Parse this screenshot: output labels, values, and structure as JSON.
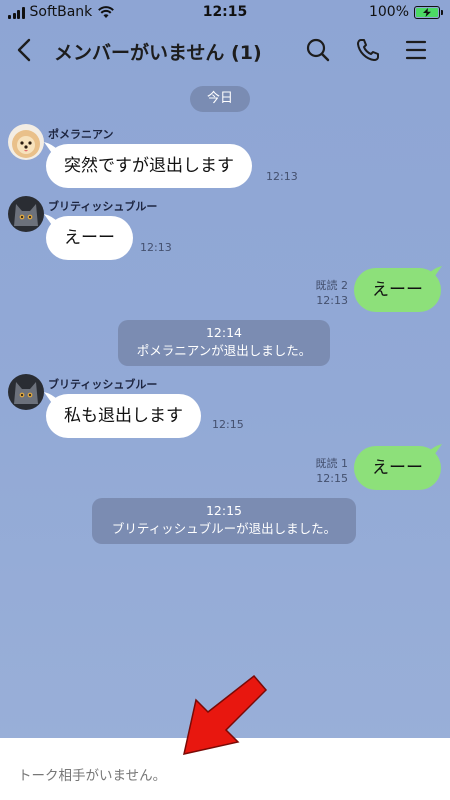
{
  "status_bar": {
    "carrier": "SoftBank",
    "time": "12:15",
    "battery": "100%"
  },
  "header": {
    "title": "メンバーがいません (1)",
    "icons": [
      "back-icon",
      "search-icon",
      "phone-icon",
      "menu-icon"
    ]
  },
  "date_chip": "今日",
  "messages": [
    {
      "type": "in",
      "sender": "ポメラニアン",
      "text": "突然ですが退出します",
      "time": "12:13"
    },
    {
      "type": "in",
      "sender": "ブリティッシュブルー",
      "text": "えーー",
      "time": "12:13"
    },
    {
      "type": "out",
      "read": "既読 2",
      "text": "えーー",
      "time": "12:13"
    },
    {
      "type": "system",
      "time": "12:14",
      "text": "ポメラニアンが退出しました。"
    },
    {
      "type": "in",
      "sender": "ブリティッシュブルー",
      "text": "私も退出します",
      "time": "12:15"
    },
    {
      "type": "out",
      "read": "既読 1",
      "text": "えーー",
      "time": "12:15"
    },
    {
      "type": "system",
      "time": "12:15",
      "text": "ブリティッシュブルーが退出しました。"
    }
  ],
  "bottom_bar": {
    "text": "トーク相手がいません。"
  },
  "colors": {
    "background": "#92a9d6",
    "outgoing_bubble": "#8de07a",
    "incoming_bubble": "#ffffff",
    "system_chip": "#7b8cb2",
    "annotation_arrow": "#e8170f"
  }
}
